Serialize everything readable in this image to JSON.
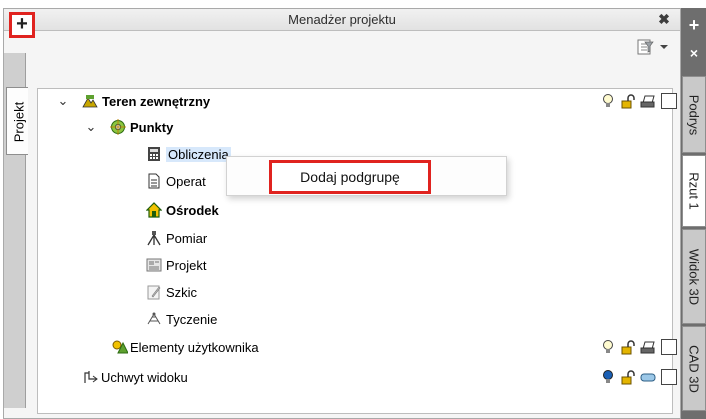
{
  "panel": {
    "title": "Menadżer projektu"
  },
  "toolbar": {
    "add_label": "+"
  },
  "left_tab": {
    "label": "Projekt"
  },
  "tree": {
    "root": "Teren zewnętrzny",
    "group": "Punkty",
    "items": [
      "Obliczenia",
      "Operat",
      "Ośrodek",
      "Pomiar",
      "Projekt",
      "Szkic",
      "Tyczenie"
    ],
    "user_elements": "Elementy użytkownika",
    "view_handle": "Uchwyt widoku"
  },
  "context_menu": {
    "item": "Dodaj podgrupę"
  },
  "right_panel": {
    "plus": "+",
    "close": "×",
    "tabs": [
      "Podrys",
      "Rzut 1",
      "Widok 3D",
      "CAD 3D"
    ]
  },
  "colors": {
    "highlight": "#e0231f",
    "selection": "#d7e8fb"
  }
}
